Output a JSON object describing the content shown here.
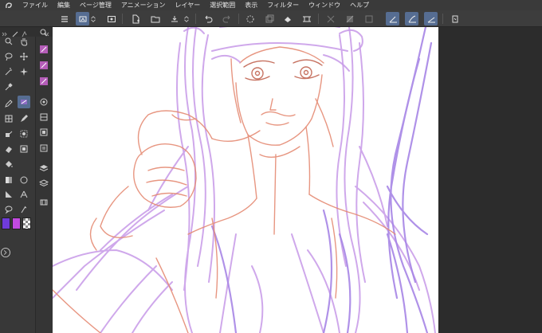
{
  "menubar": {
    "items": [
      "ファイル",
      "編集",
      "ページ管理",
      "アニメーション",
      "レイヤー",
      "選択範囲",
      "表示",
      "フィルター",
      "ウィンドウ",
      "ヘルプ"
    ]
  },
  "colors": {
    "main": "#6f3bd9",
    "sub": "#c24ae0",
    "accent_active": "#566d92"
  },
  "commandbar": {
    "icons": [
      "hamburger-icon",
      "new-canvas-icon",
      "open-icon",
      "save-icon",
      "undo-icon",
      "redo-icon",
      "loading-icon",
      "fill-icon",
      "transform-icon",
      "crop-icon",
      "snap-ruler-icon",
      "snap-grid-icon",
      "snap-special-icon",
      "stabilizer-icon",
      "companion-icon"
    ]
  },
  "tools": {
    "icons": [
      "magnifier-icon",
      "hand-icon",
      "lasso-icon",
      "move-icon",
      "sparkle-icon",
      "eyedropper-icon",
      "pen-icon",
      "marker-icon",
      "pencil-icon",
      "brush-icon",
      "airbrush-icon",
      "blend-icon",
      "eraser-icon",
      "fill-bucket-icon",
      "gradient-icon",
      "circle-icon",
      "ruler-icon",
      "text-icon",
      "balloon-icon",
      "correction-icon"
    ]
  }
}
